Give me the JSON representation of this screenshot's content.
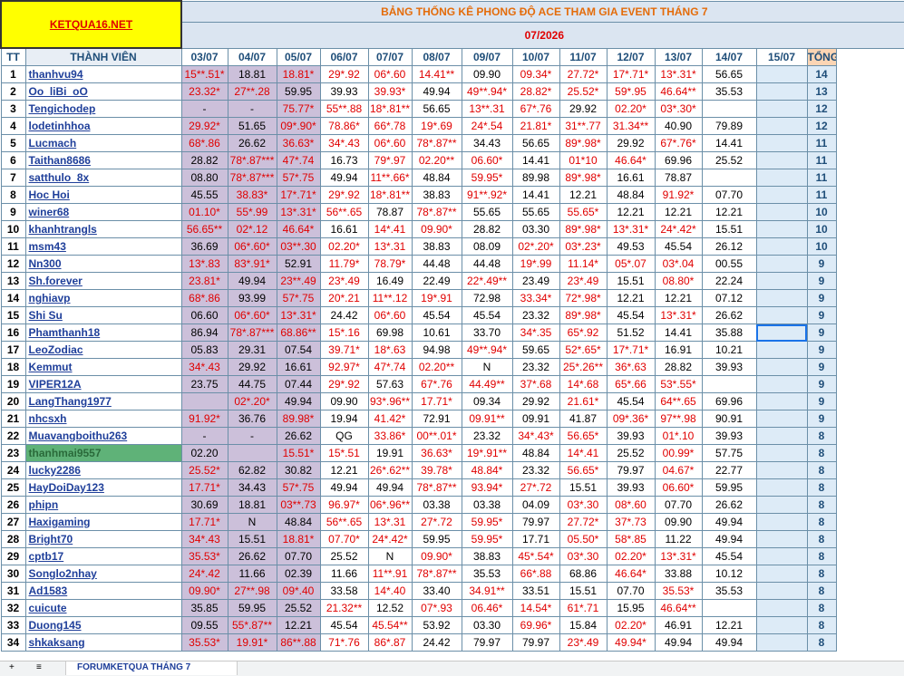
{
  "logo": "KETQUA16.NET",
  "banner": "BẢNG THỐNG KÊ PHONG ĐỘ ACE THAM GIA EVENT THÁNG 7",
  "month": "07/2026",
  "headers": {
    "tt": "TT",
    "member": "THÀNH VIÊN",
    "total": "TỔNG KẾT",
    "dates": [
      "03/07",
      "04/07",
      "05/07",
      "06/07",
      "07/07",
      "08/07",
      "09/07",
      "10/07",
      "11/07",
      "12/07",
      "13/07",
      "14/07",
      "15/07"
    ]
  },
  "rows": [
    {
      "tt": "1",
      "name": "thanhvu94",
      "cells": [
        "15**.51*",
        "18.81",
        "18.81*",
        "29*.92",
        "06*.60",
        "14.41**",
        "09.90",
        "09.34*",
        "27.72*",
        "17*.71*",
        "13*.31*",
        "56.65",
        ""
      ],
      "total": "14"
    },
    {
      "tt": "2",
      "name": "Oo_liBi_oO",
      "cells": [
        "23.32*",
        "27**.28",
        "59.95",
        "39.93",
        "39.93*",
        "49.94",
        "49**.94*",
        "28.82*",
        "25.52*",
        "59*.95",
        "46.64**",
        "35.53",
        ""
      ],
      "total": "13"
    },
    {
      "tt": "3",
      "name": "Tengichodep",
      "cells": [
        "-",
        "-",
        "75.77*",
        "55**.88",
        "18*.81**",
        "56.65",
        "13**.31",
        "67*.76",
        "29.92",
        "02.20*",
        "03*.30*",
        "",
        ""
      ],
      "total": "12"
    },
    {
      "tt": "4",
      "name": "lodetinhhoa",
      "cells": [
        "29.92*",
        "51.65",
        "09*.90*",
        "78.86*",
        "66*.78",
        "19*.69",
        "24*.54",
        "21.81*",
        "31**.77",
        "31.34**",
        "40.90",
        "79.89",
        ""
      ],
      "total": "12"
    },
    {
      "tt": "5",
      "name": "Lucmach",
      "cells": [
        "68*.86",
        "26.62",
        "36.63*",
        "34*.43",
        "06*.60",
        "78*.87**",
        "34.43",
        "56.65",
        "89*.98*",
        "29.92",
        "67*.76*",
        "14.41",
        ""
      ],
      "total": "11"
    },
    {
      "tt": "6",
      "name": "Taithan8686",
      "cells": [
        "28.82",
        "78*.87***",
        "47*.74",
        "16.73",
        "79*.97",
        "02.20**",
        "06.60*",
        "14.41",
        "01*10",
        "46.64*",
        "69.96",
        "25.52",
        ""
      ],
      "total": "11"
    },
    {
      "tt": "7",
      "name": "satthulo_8x",
      "cells": [
        "08.80",
        "78*.87***",
        "57*.75",
        "49.94",
        "11**.66*",
        "48.84",
        "59.95*",
        "89.98",
        "89*.98*",
        "16.61",
        "78.87",
        "",
        ""
      ],
      "total": "11"
    },
    {
      "tt": "8",
      "name": "Hoc Hoi",
      "cells": [
        "45.55",
        "38.83*",
        "17*.71*",
        "29*.92",
        "18*.81**",
        "38.83",
        "91**.92*",
        "14.41",
        "12.21",
        "48.84",
        "91.92*",
        "07.70",
        ""
      ],
      "total": "11"
    },
    {
      "tt": "9",
      "name": "winer68",
      "cells": [
        "01.10*",
        "55*.99",
        "13*.31*",
        "56**.65",
        "78.87",
        "78*.87**",
        "55.65",
        "55.65",
        "55.65*",
        "12.21",
        "12.21",
        "12.21",
        ""
      ],
      "total": "10"
    },
    {
      "tt": "10",
      "name": "khanhtrangls",
      "cells": [
        "56.65**",
        "02*.12",
        "46.64*",
        "16.61",
        "14*.41",
        "09.90*",
        "28.82",
        "03.30",
        "89*.98*",
        "13*.31*",
        "24*.42*",
        "15.51",
        ""
      ],
      "total": "10"
    },
    {
      "tt": "11",
      "name": "msm43",
      "cells": [
        "36.69",
        "06*.60*",
        "03**.30",
        "02.20*",
        "13*.31",
        "38.83",
        "08.09",
        "02*.20*",
        "03*.23*",
        "49.53",
        "45.54",
        "26.12",
        ""
      ],
      "total": "10"
    },
    {
      "tt": "12",
      "name": "Nn300",
      "cells": [
        "13*.83",
        "83*.91*",
        "52.91",
        "11.79*",
        "78.79*",
        "44.48",
        "44.48",
        "19*.99",
        "11.14*",
        "05*.07",
        "03*.04",
        "00.55",
        ""
      ],
      "total": "9"
    },
    {
      "tt": "13",
      "name": "Sh.forever",
      "cells": [
        "23.81*",
        "49.94",
        "23**.49",
        "23*.49",
        "16.49",
        "22.49",
        "22*.49**",
        "23.49",
        "23*.49",
        "15.51",
        "08.80*",
        "22.24",
        ""
      ],
      "total": "9"
    },
    {
      "tt": "14",
      "name": "nghiavp",
      "cells": [
        "68*.86",
        "93.99",
        "57*.75",
        "20*.21",
        "11**.12",
        "19*.91",
        "72.98",
        "33.34*",
        "72*.98*",
        "12.21",
        "12.21",
        "07.12",
        ""
      ],
      "total": "9"
    },
    {
      "tt": "15",
      "name": "Shi Su",
      "cells": [
        "06.60",
        "06*.60*",
        "13*.31*",
        "24.42",
        "06*.60",
        "45.54",
        "45.54",
        "23.32",
        "89*.98*",
        "45.54",
        "13*.31*",
        "26.62",
        ""
      ],
      "total": "9"
    },
    {
      "tt": "16",
      "name": "Phamthanh18",
      "cells": [
        "86.94",
        "78*.87***",
        "68.86**",
        "15*.16",
        "69.98",
        "10.61",
        "33.70",
        "34*.35",
        "65*.92",
        "51.52",
        "14.41",
        "35.88",
        ""
      ],
      "total": "9"
    },
    {
      "tt": "17",
      "name": "LeoZodiac",
      "cells": [
        "05.83",
        "29.31",
        "07.54",
        "39.71*",
        "18*.63",
        "94.98",
        "49**.94*",
        "59.65",
        "52*.65*",
        "17*.71*",
        "16.91",
        "10.21",
        ""
      ],
      "total": "9"
    },
    {
      "tt": "18",
      "name": "Kemmut",
      "cells": [
        "34*.43",
        "29.92",
        "16.61",
        "92.97*",
        "47*.74",
        "02.20**",
        "N",
        "23.32",
        "25*.26**",
        "36*.63",
        "28.82",
        "39.93",
        ""
      ],
      "total": "9"
    },
    {
      "tt": "19",
      "name": "VIPER12A",
      "cells": [
        "23.75",
        "44.75",
        "07.44",
        "29*.92",
        "57.63",
        "67*.76",
        "44.49**",
        "37*.68",
        "14*.68",
        "65*.66",
        "53*.55*",
        "",
        ""
      ],
      "total": "9"
    },
    {
      "tt": "20",
      "name": "LangThang1977",
      "cells": [
        "",
        "02*.20*",
        "49.94",
        "09.90",
        "93*.96**",
        "17.71*",
        "09.34",
        "29.92",
        "21.61*",
        "45.54",
        "64**.65",
        "69.96",
        ""
      ],
      "total": "9"
    },
    {
      "tt": "21",
      "name": "nhcsxh",
      "cells": [
        "91.92*",
        "36.76",
        "89.98*",
        "19.94",
        "41.42*",
        "72.91",
        "09.91**",
        "09.91",
        "41.87",
        "09*.36*",
        "97**.98",
        "90.91",
        ""
      ],
      "total": "9"
    },
    {
      "tt": "22",
      "name": "Muavangboithu263",
      "cells": [
        "-",
        "-",
        "26.62",
        "QG",
        "33.86*",
        "00**.01*",
        "23.32",
        "34*.43*",
        "56.65*",
        "39.93",
        "01*.10",
        "39.93",
        ""
      ],
      "total": "8"
    },
    {
      "tt": "23",
      "name": "thanhmai9557",
      "cells": [
        "02.20",
        "",
        "15.51*",
        "15*.51",
        "19.91",
        "36.63*",
        "19*.91**",
        "48.84",
        "14*.41",
        "25.52",
        "00.99*",
        "57.75",
        ""
      ],
      "total": "8"
    },
    {
      "tt": "24",
      "name": "lucky2286",
      "cells": [
        "25.52*",
        "62.82",
        "30.82",
        "12.21",
        "26*.62**",
        "39.78*",
        "48.84*",
        "23.32",
        "56.65*",
        "79.97",
        "04.67*",
        "22.77",
        ""
      ],
      "total": "8"
    },
    {
      "tt": "25",
      "name": "HayDoiDay123",
      "cells": [
        "17.71*",
        "34.43",
        "57*.75",
        "49.94",
        "49.94",
        "78*.87**",
        "93.94*",
        "27*.72",
        "15.51",
        "39.93",
        "06.60*",
        "59.95",
        ""
      ],
      "total": "8"
    },
    {
      "tt": "26",
      "name": "phipn",
      "cells": [
        "30.69",
        "18.81",
        "03**.73",
        "96.97*",
        "06*.96**",
        "03.38",
        "03.38",
        "04.09",
        "03*.30",
        "08*.60",
        "07.70",
        "26.62",
        ""
      ],
      "total": "8"
    },
    {
      "tt": "27",
      "name": "Haxigaming",
      "cells": [
        "17.71*",
        "N",
        "48.84",
        "56**.65",
        "13*.31",
        "27*.72",
        "59.95*",
        "79.97",
        "27.72*",
        "37*.73",
        "09.90",
        "49.94",
        ""
      ],
      "total": "8"
    },
    {
      "tt": "28",
      "name": "Bright70",
      "cells": [
        "34*.43",
        "15.51",
        "18.81*",
        "07.70*",
        "24*.42*",
        "59.95",
        "59.95*",
        "17.71",
        "05.50*",
        "58*.85",
        "11.22",
        "49.94",
        ""
      ],
      "total": "8"
    },
    {
      "tt": "29",
      "name": "cptb17",
      "cells": [
        "35.53*",
        "26.62",
        "07.70",
        "25.52",
        "N",
        "09.90*",
        "38.83",
        "45*.54*",
        "03*.30",
        "02.20*",
        "13*.31*",
        "45.54",
        ""
      ],
      "total": "8"
    },
    {
      "tt": "30",
      "name": "Songlo2nhay",
      "cells": [
        "24*.42",
        "11.66",
        "02.39",
        "11.66",
        "11**.91",
        "78*.87**",
        "35.53",
        "66*.88",
        "68.86",
        "46.64*",
        "33.88",
        "10.12",
        ""
      ],
      "total": "8"
    },
    {
      "tt": "31",
      "name": "Ad1583",
      "cells": [
        "09.90*",
        "27**.98",
        "09*.40",
        "33.58",
        "14*.40",
        "33.40",
        "34.91**",
        "33.51",
        "15.51",
        "07.70",
        "35.53*",
        "35.53",
        ""
      ],
      "total": "8"
    },
    {
      "tt": "32",
      "name": "cuicute",
      "cells": [
        "35.85",
        "59.95",
        "25.52",
        "21.32**",
        "12.52",
        "07*.93",
        "06.46*",
        "14.54*",
        "61*.71",
        "15.95",
        "46.64**",
        "",
        ""
      ],
      "total": "8"
    },
    {
      "tt": "33",
      "name": "Duong145",
      "cells": [
        "09.55",
        "55*.87**",
        "12.21",
        "45.54",
        "45.54**",
        "53.92",
        "03.30",
        "69.96*",
        "15.84",
        "02.20*",
        "46.91",
        "12.21",
        ""
      ],
      "total": "8"
    },
    {
      "tt": "34",
      "name": "shkaksang",
      "cells": [
        "35.53*",
        "19.91*",
        "86**.88",
        "71*.76",
        "86*.87",
        "24.42",
        "79.97",
        "79.97",
        "23*.49",
        "49.94*",
        "49.94",
        "49.94",
        ""
      ],
      "total": "8"
    }
  ],
  "footer": {
    "add": "+",
    "menu": "≡",
    "tab": "FORUMKETQUA THÁNG 7"
  }
}
